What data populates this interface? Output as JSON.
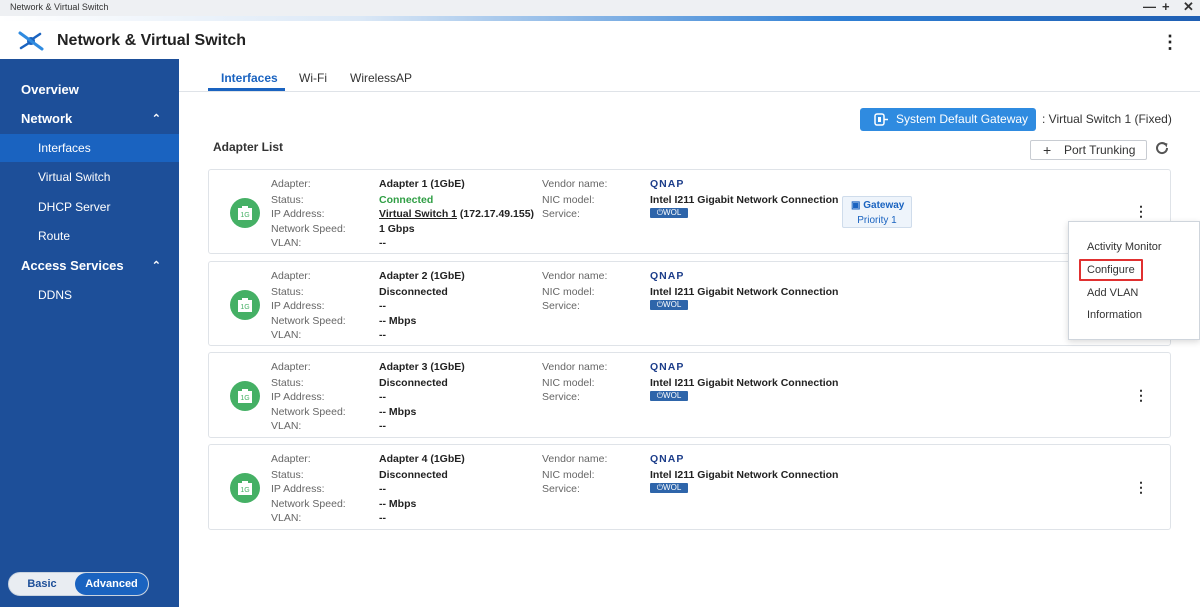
{
  "window": {
    "title": "Network & Virtual Switch",
    "controls": [
      "—",
      "+",
      "✕"
    ]
  },
  "app": {
    "title": "Network & Virtual Switch",
    "menu_icon": "kebab-menu-icon"
  },
  "sidebar": {
    "items": [
      {
        "label": "Overview",
        "type": "section"
      },
      {
        "label": "Network",
        "type": "section",
        "expanded": true
      },
      {
        "label": "Interfaces",
        "type": "sub",
        "active": true
      },
      {
        "label": "Virtual Switch",
        "type": "sub"
      },
      {
        "label": "DHCP Server",
        "type": "sub"
      },
      {
        "label": "Route",
        "type": "sub"
      },
      {
        "label": "Access Services",
        "type": "section",
        "expanded": true
      },
      {
        "label": "DDNS",
        "type": "sub"
      }
    ],
    "mode": {
      "basic": "Basic",
      "advanced": "Advanced",
      "selected": "Advanced"
    }
  },
  "tabs": [
    "Interfaces",
    "Wi-Fi",
    "WirelessAP"
  ],
  "active_tab": "Interfaces",
  "gateway": {
    "button_label": "System Default Gateway",
    "info": ": Virtual Switch 1 (Fixed)"
  },
  "adapter_list": {
    "title": "Adapter List",
    "port_trunking_label": "Port Trunking",
    "labels": {
      "adapter": "Adapter:",
      "status": "Status:",
      "ip": "IP Address:",
      "speed": "Network Speed:",
      "vlan": "VLAN:",
      "vendor": "Vendor name:",
      "nic": "NIC model:",
      "service": "Service:"
    },
    "adapters": [
      {
        "icon_text": "1G",
        "adapter": "Adapter 1 (1GbE)",
        "status": "Connected",
        "ip_link": "Virtual Switch 1",
        "ip_rest": " (172.17.49.155)",
        "speed": "1 Gbps",
        "vlan": "--",
        "vendor": "QNAP",
        "nic": "Intel I211 Gigabit Network Connection",
        "service": "WOL",
        "gateway_badge": "Gateway",
        "priority": "Priority 1"
      },
      {
        "icon_text": "1G",
        "adapter": "Adapter 2 (1GbE)",
        "status": "Disconnected",
        "ip": "--",
        "speed": "-- Mbps",
        "vlan": "--",
        "vendor": "QNAP",
        "nic": "Intel I211 Gigabit Network Connection",
        "service": "WOL"
      },
      {
        "icon_text": "1G",
        "adapter": "Adapter 3 (1GbE)",
        "status": "Disconnected",
        "ip": "--",
        "speed": "-- Mbps",
        "vlan": "--",
        "vendor": "QNAP",
        "nic": "Intel I211 Gigabit Network Connection",
        "service": "WOL"
      },
      {
        "icon_text": "1G",
        "adapter": "Adapter 4 (1GbE)",
        "status": "Disconnected",
        "ip": "--",
        "speed": "-- Mbps",
        "vlan": "--",
        "vendor": "QNAP",
        "nic": "Intel I211 Gigabit Network Connection",
        "service": "WOL"
      }
    ]
  },
  "context_menu": {
    "items": [
      "Activity Monitor",
      "Configure",
      "Add VLAN",
      "Information"
    ],
    "highlighted": "Configure"
  },
  "colors": {
    "sidebar": "#1d4f99",
    "accent": "#1a63c0",
    "connected": "#2f9e44",
    "adapter_icon": "#45b065",
    "highlight_border": "#e03030"
  }
}
